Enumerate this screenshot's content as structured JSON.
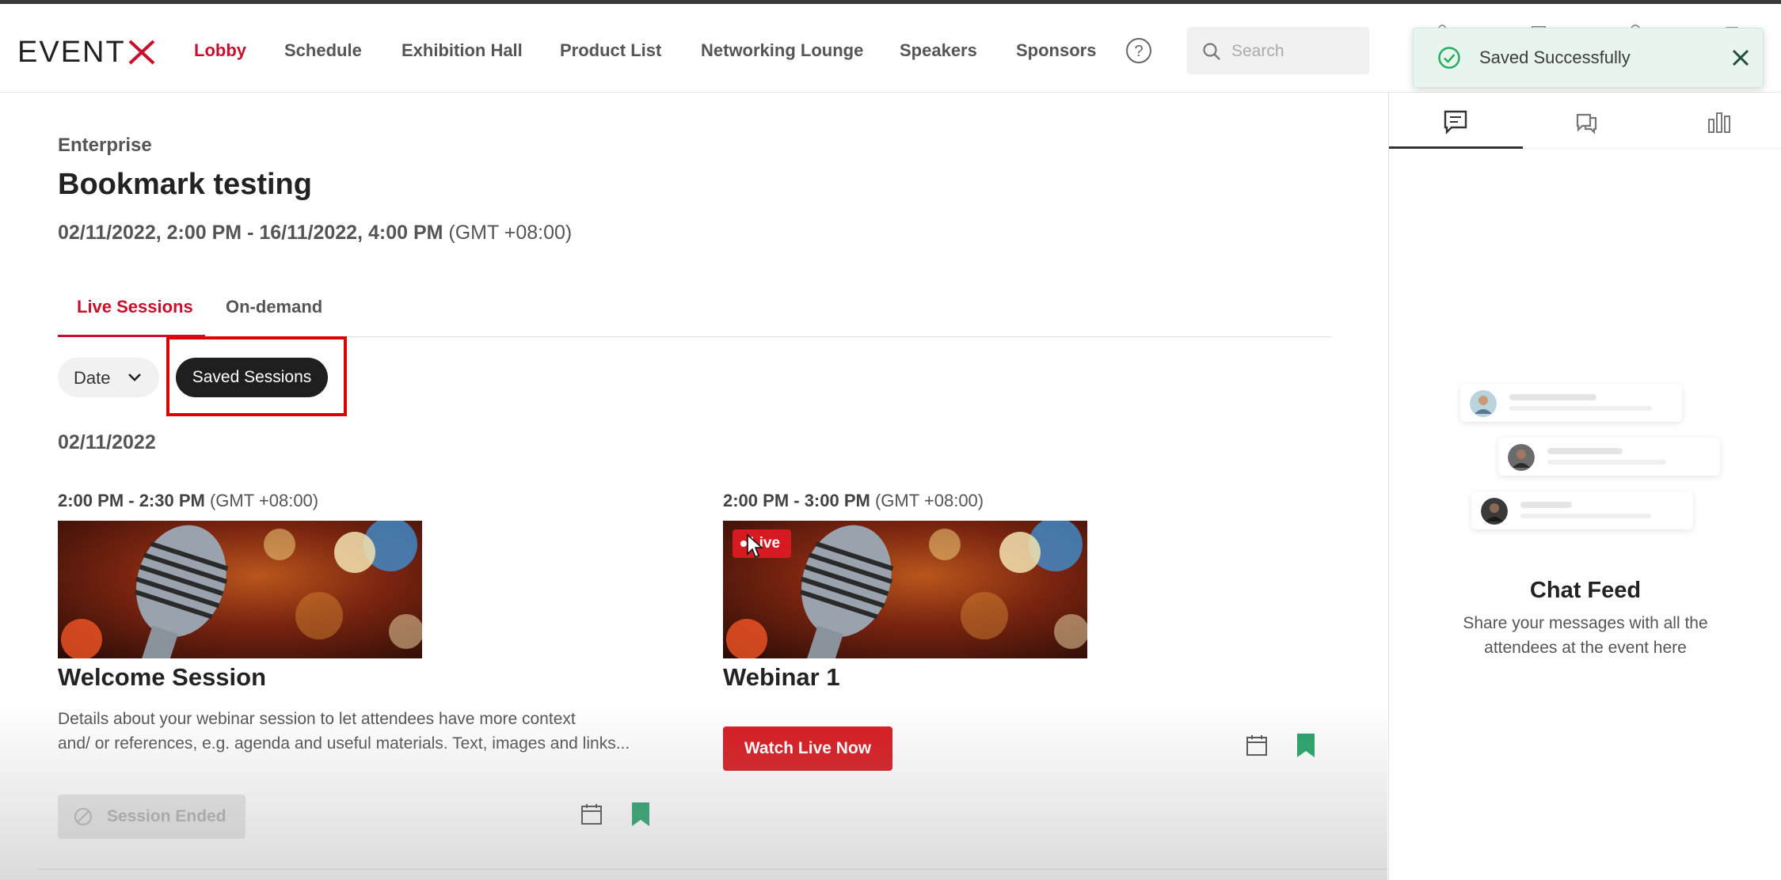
{
  "brand": {
    "logo_text": "EVENTX",
    "accent": "#c8102e"
  },
  "nav": {
    "items": [
      {
        "label": "Lobby",
        "active": true
      },
      {
        "label": "Schedule",
        "active": false
      },
      {
        "label": "Exhibition Hall",
        "active": false
      },
      {
        "label": "Product List",
        "active": false
      },
      {
        "label": "Networking Lounge",
        "active": false
      },
      {
        "label": "Speakers",
        "active": false
      },
      {
        "label": "Sponsors",
        "active": false
      }
    ],
    "help_icon": "question-circle-icon",
    "search": {
      "placeholder": "Search",
      "value": ""
    }
  },
  "toast": {
    "message": "Saved Successfully",
    "icon": "check-circle-icon",
    "color": "#27ae60"
  },
  "event": {
    "organizer": "Enterprise",
    "title": "Bookmark testing",
    "date_range": "02/11/2022, 2:00 PM - 16/11/2022, 4:00 PM",
    "timezone": "(GMT +08:00)"
  },
  "tabs": [
    {
      "label": "Live Sessions",
      "active": true
    },
    {
      "label": "On-demand",
      "active": false
    }
  ],
  "filters": {
    "date_label": "Date",
    "saved_label": "Saved Sessions"
  },
  "schedule_day": "02/11/2022",
  "sessions": [
    {
      "time": "2:00 PM - 2:30 PM",
      "timezone": "(GMT +08:00)",
      "title": "Welcome Session",
      "description_line1": "Details about your webinar session to let attendees have more context",
      "description_line2": "and/ or references, e.g. agenda and useful materials. Text, images and links...",
      "status_label": "Session Ended",
      "bookmarked": true
    },
    {
      "time": "2:00 PM - 3:00 PM",
      "timezone": "(GMT +08:00)",
      "title": "Webinar 1",
      "live_badge": "Live",
      "action_label": "Watch Live Now",
      "bookmarked": true
    }
  ],
  "chat_panel": {
    "tabs": [
      "chat-icon",
      "qa-icon",
      "poll-icon"
    ],
    "title": "Chat Feed",
    "subtitle": "Share your messages with all the attendees at the event here"
  }
}
